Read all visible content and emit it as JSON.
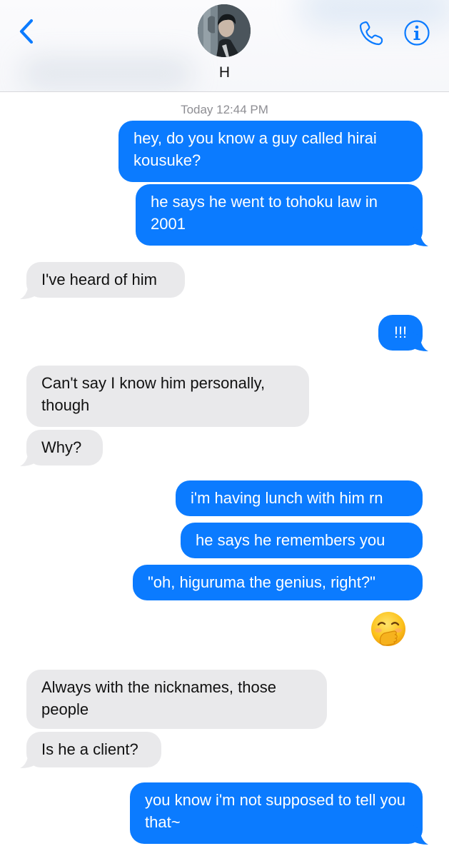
{
  "header": {
    "contact_name": "H"
  },
  "timestamp": "Today 12:44 PM",
  "messages": [
    {
      "from": "me",
      "text": "hey, do you know a guy called hirai kousuke?"
    },
    {
      "from": "me",
      "text": "he says he went to tohoku law in 2001"
    },
    {
      "from": "them",
      "text": "I've heard of him"
    },
    {
      "from": "me",
      "text": "!!!"
    },
    {
      "from": "them",
      "text": "Can't say I know him personally, though"
    },
    {
      "from": "them",
      "text": "Why?"
    },
    {
      "from": "me",
      "text": "i'm having lunch with him rn"
    },
    {
      "from": "me",
      "text": "he says he remembers you"
    },
    {
      "from": "me",
      "text": "\"oh, higuruma the genius, right?\""
    },
    {
      "from": "me",
      "emoji": "face-with-hand-over-mouth"
    },
    {
      "from": "them",
      "text": "Always with the nicknames, those people"
    },
    {
      "from": "them",
      "text": "Is he a client?"
    },
    {
      "from": "me",
      "text": "you know i'm not supposed to tell you that~"
    }
  ],
  "colors": {
    "outgoing_bubble": "#0b7bff",
    "incoming_bubble": "#e9e9eb",
    "accent": "#0b7bff",
    "timestamp": "#8e8e93"
  }
}
